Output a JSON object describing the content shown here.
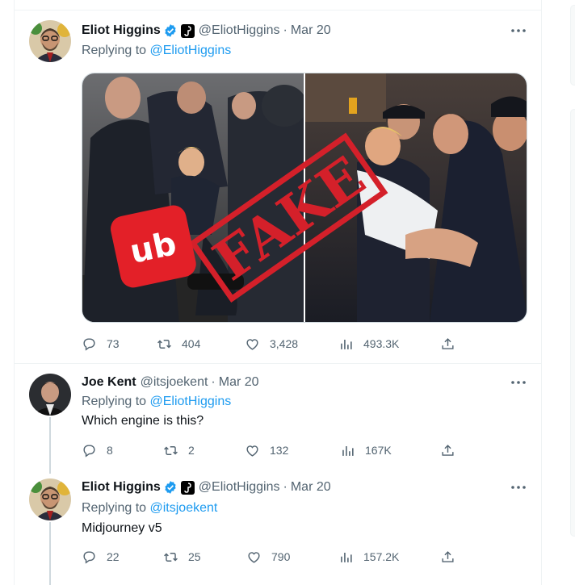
{
  "tweets": [
    {
      "name": "Eliot Higgins",
      "handle": "@EliotHiggins",
      "date": "Mar 20",
      "replying_label": "Replying to",
      "replying_to": "@EliotHiggins",
      "text": "",
      "image_logo_text": "ub",
      "image_stamp_text": "FAKE",
      "stats": {
        "replies": "73",
        "retweets": "404",
        "likes": "3,428",
        "views": "493.3K"
      }
    },
    {
      "name": "Joe Kent",
      "handle": "@itsjoekent",
      "date": "Mar 20",
      "replying_label": "Replying to",
      "replying_to": "@EliotHiggins",
      "text": "Which engine is this?",
      "stats": {
        "replies": "8",
        "retweets": "2",
        "likes": "132",
        "views": "167K"
      }
    },
    {
      "name": "Eliot Higgins",
      "handle": "@EliotHiggins",
      "date": "Mar 20",
      "replying_label": "Replying to",
      "replying_to": "@itsjoekent",
      "text": "Midjourney v5",
      "stats": {
        "replies": "22",
        "retweets": "25",
        "likes": "790",
        "views": "157.2K"
      }
    }
  ],
  "separator": "·",
  "colors": {
    "accent": "#1d9bf0",
    "muted": "#536471",
    "text": "#0f1419",
    "stamp": "#d4202a"
  },
  "icons": [
    "verified-badge-icon",
    "affiliate-badge-icon",
    "more-icon",
    "reply-icon",
    "retweet-icon",
    "like-icon",
    "views-icon",
    "share-icon"
  ]
}
